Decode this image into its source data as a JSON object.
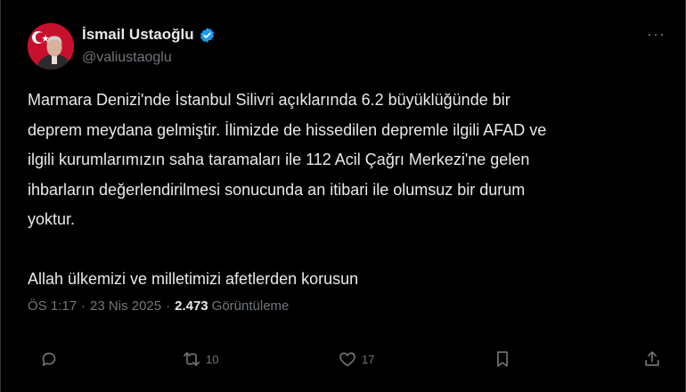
{
  "user": {
    "display_name": "İsmail Ustaoğlu",
    "handle": "@valiustaoglu"
  },
  "more_label": "···",
  "tweet": {
    "text": "Marmara Denizi'nde İstanbul Silivri açıklarında 6.2 büyüklüğünde bir\ndeprem meydana gelmiştir. İlimizde de hissedilen depremle ilgili AFAD ve\nilgili kurumlarımızın saha taramaları ile 112 Acil Çağrı Merkezi'ne gelen\nihbarların değerlendirilmesi sonucunda an itibari ile olumsuz bir durum\nyoktur.\n\nAllah ülkemizi ve milletimizi afetlerden korusun"
  },
  "meta": {
    "time": "ÖS 1:17",
    "separator": "·",
    "date": "23 Nis 2025",
    "views_count": "2.473",
    "views_label": "Görüntüleme"
  },
  "actions": {
    "reply_count": "",
    "retweet_count": "10",
    "like_count": "17"
  },
  "colors": {
    "background": "#000000",
    "text": "#e7e9ea",
    "muted": "#71767b",
    "verified": "#1d9bf0",
    "avatar_flag": "#c8102e"
  },
  "icons": [
    "verified-badge-icon",
    "more-icon",
    "reply-icon",
    "retweet-icon",
    "like-icon",
    "bookmark-icon",
    "share-icon"
  ]
}
